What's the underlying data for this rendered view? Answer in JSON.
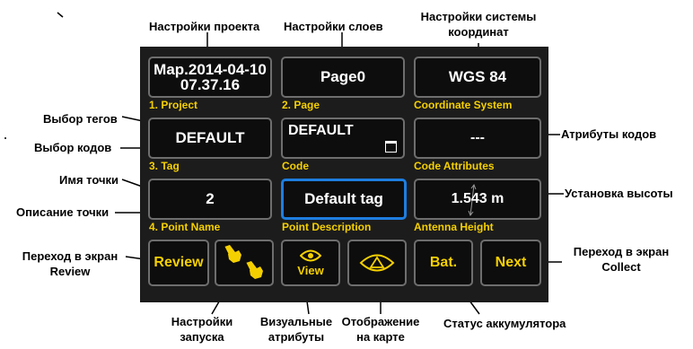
{
  "fields": {
    "project": {
      "line1": "Map.2014-04-10",
      "line2": "07.37.16",
      "label": "1. Project"
    },
    "page": {
      "value": "Page0",
      "label": "2. Page"
    },
    "coordinate_system": {
      "value": "WGS 84",
      "label": "Coordinate System"
    },
    "tag": {
      "value": "DEFAULT",
      "label": "3. Tag"
    },
    "code": {
      "value": "DEFAULT",
      "label": "Code"
    },
    "code_attributes": {
      "value": "---",
      "label": "Code Attributes"
    },
    "point_name": {
      "value": "2",
      "label": "4. Point Name"
    },
    "point_description": {
      "value": "Default tag",
      "label": "Point Description"
    },
    "antenna_height": {
      "value": "1.543 m",
      "label": "Antenna Height"
    }
  },
  "buttons": {
    "review": "Review",
    "view": "View",
    "battery": "Bat.",
    "next": "Next"
  },
  "annotations": {
    "project_settings": "Настройки проекта",
    "layer_settings": "Настройки слоев",
    "coord_settings_line1": "Настройки системы",
    "coord_settings_line2": "координат",
    "tag_select": "Выбор тегов",
    "code_select": "Выбор кодов",
    "code_attributes": "Атрибуты кодов",
    "point_name": "Имя точки",
    "height_setup": "Установка высоты",
    "point_description": "Описание точки",
    "goto_review_line1": "Переход в экран",
    "goto_review_line2": "Review",
    "goto_collect_line1": "Переход в экран",
    "goto_collect_line2": "Collect",
    "launch_settings_line1": "Настройки",
    "launch_settings_line2": "запуска",
    "visual_attrs_line1": "Визуальные",
    "visual_attrs_line2": "атрибуты",
    "map_display_line1": "Отображение",
    "map_display_line2": "на карте",
    "battery_status": "Статус аккумулятора"
  },
  "colors": {
    "screen_bg": "#1c1c1c",
    "field_bg": "#0d0d0d",
    "field_border": "#6e6e6e",
    "active_border": "#1e7ee0",
    "label_yellow": "#f5d000",
    "text_white": "#ffffff"
  },
  "icons": {
    "launch": "pointing-hands-icon",
    "view": "eye-icon",
    "map_display": "eye-triangle-icon",
    "code_picker": "square-icon",
    "antenna_height": "vertical-arrow-icon"
  }
}
